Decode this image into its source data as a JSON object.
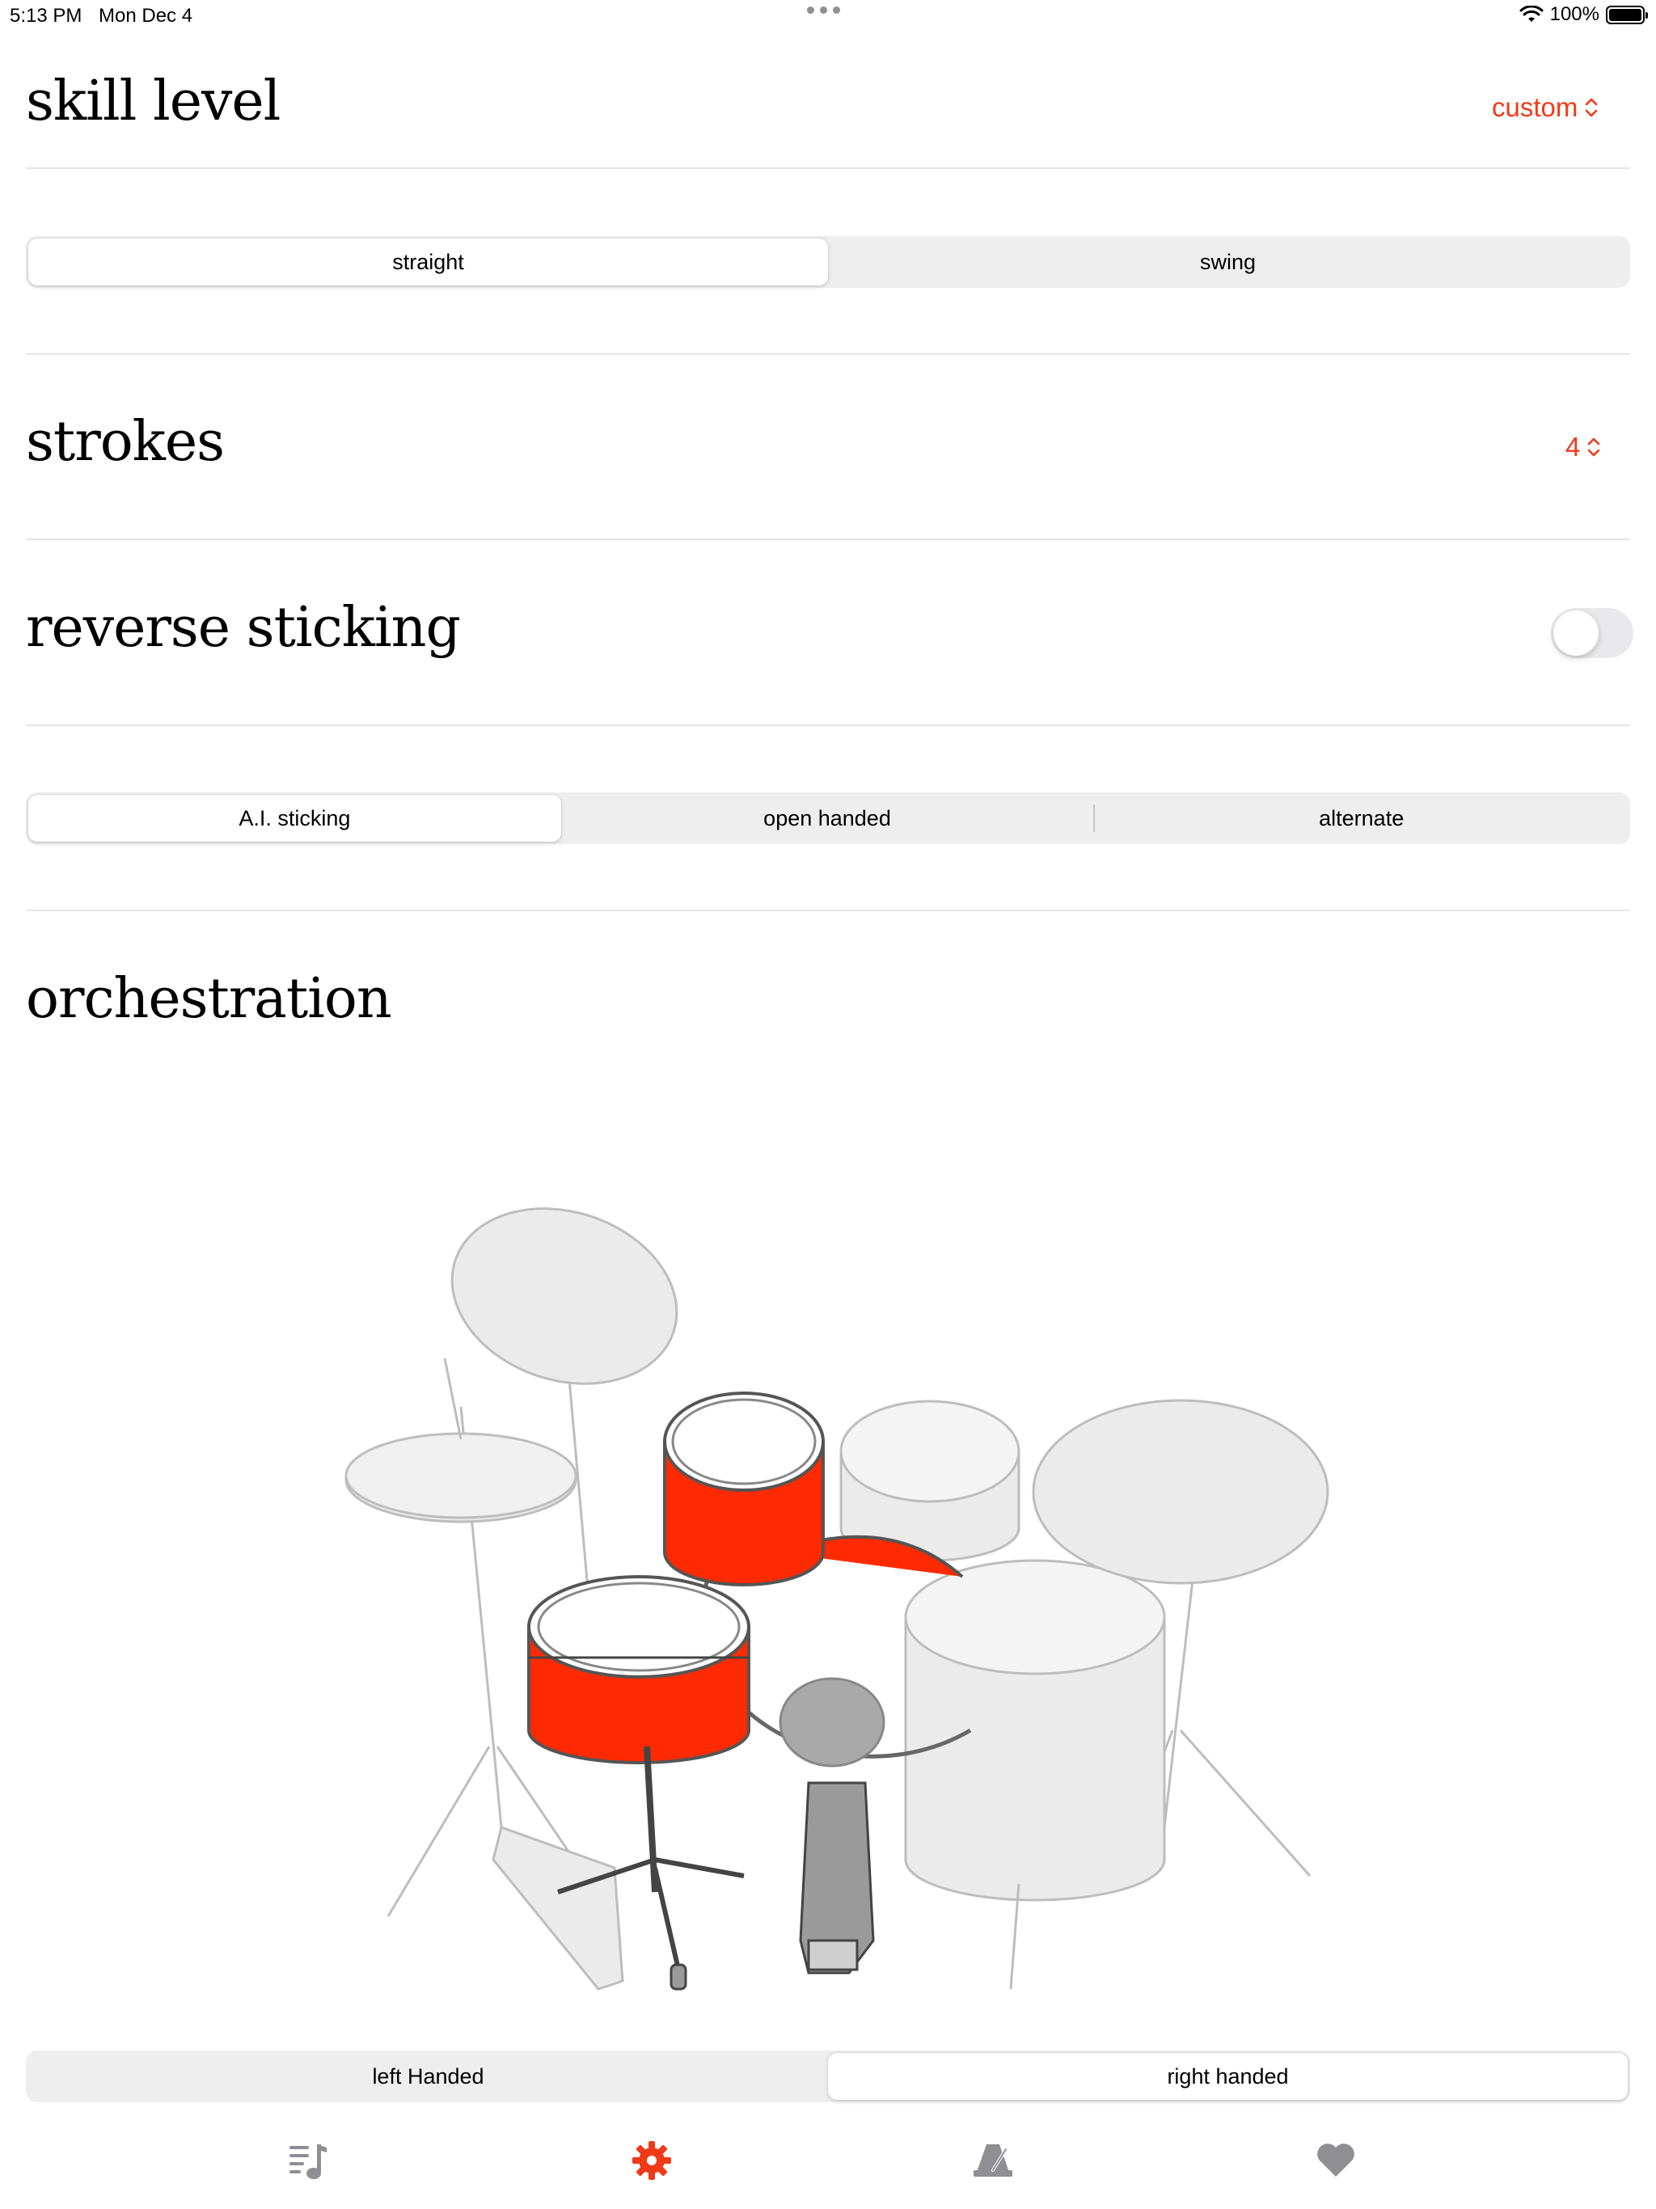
{
  "status_bar": {
    "time": "5:13 PM",
    "date": "Mon Dec 4",
    "battery": "100%"
  },
  "skill_level": {
    "title": "skill level",
    "value": "custom"
  },
  "feel": {
    "options": [
      "straight",
      "swing"
    ],
    "selected": "straight"
  },
  "strokes": {
    "title": "strokes",
    "value": "4"
  },
  "reverse_sticking": {
    "title": "reverse sticking",
    "enabled": false
  },
  "sticking": {
    "options": [
      "A.I. sticking",
      "open handed",
      "alternate"
    ],
    "selected": "A.I. sticking"
  },
  "orchestration": {
    "title": "orchestration",
    "highlighted_drums": [
      "snare",
      "rack tom",
      "kick drum"
    ],
    "handedness": {
      "options": [
        "left Handed",
        "right handed"
      ],
      "selected": "right handed"
    }
  },
  "tab_bar": {
    "tabs": [
      {
        "icon": "music-list-icon",
        "active": false
      },
      {
        "icon": "gear-icon",
        "active": true
      },
      {
        "icon": "metronome-icon",
        "active": false
      },
      {
        "icon": "heart-icon",
        "active": false
      }
    ]
  },
  "colors": {
    "accent": "#f03a17",
    "drum_highlight": "#ff2a00",
    "inactive_icon": "#8e8e93"
  }
}
